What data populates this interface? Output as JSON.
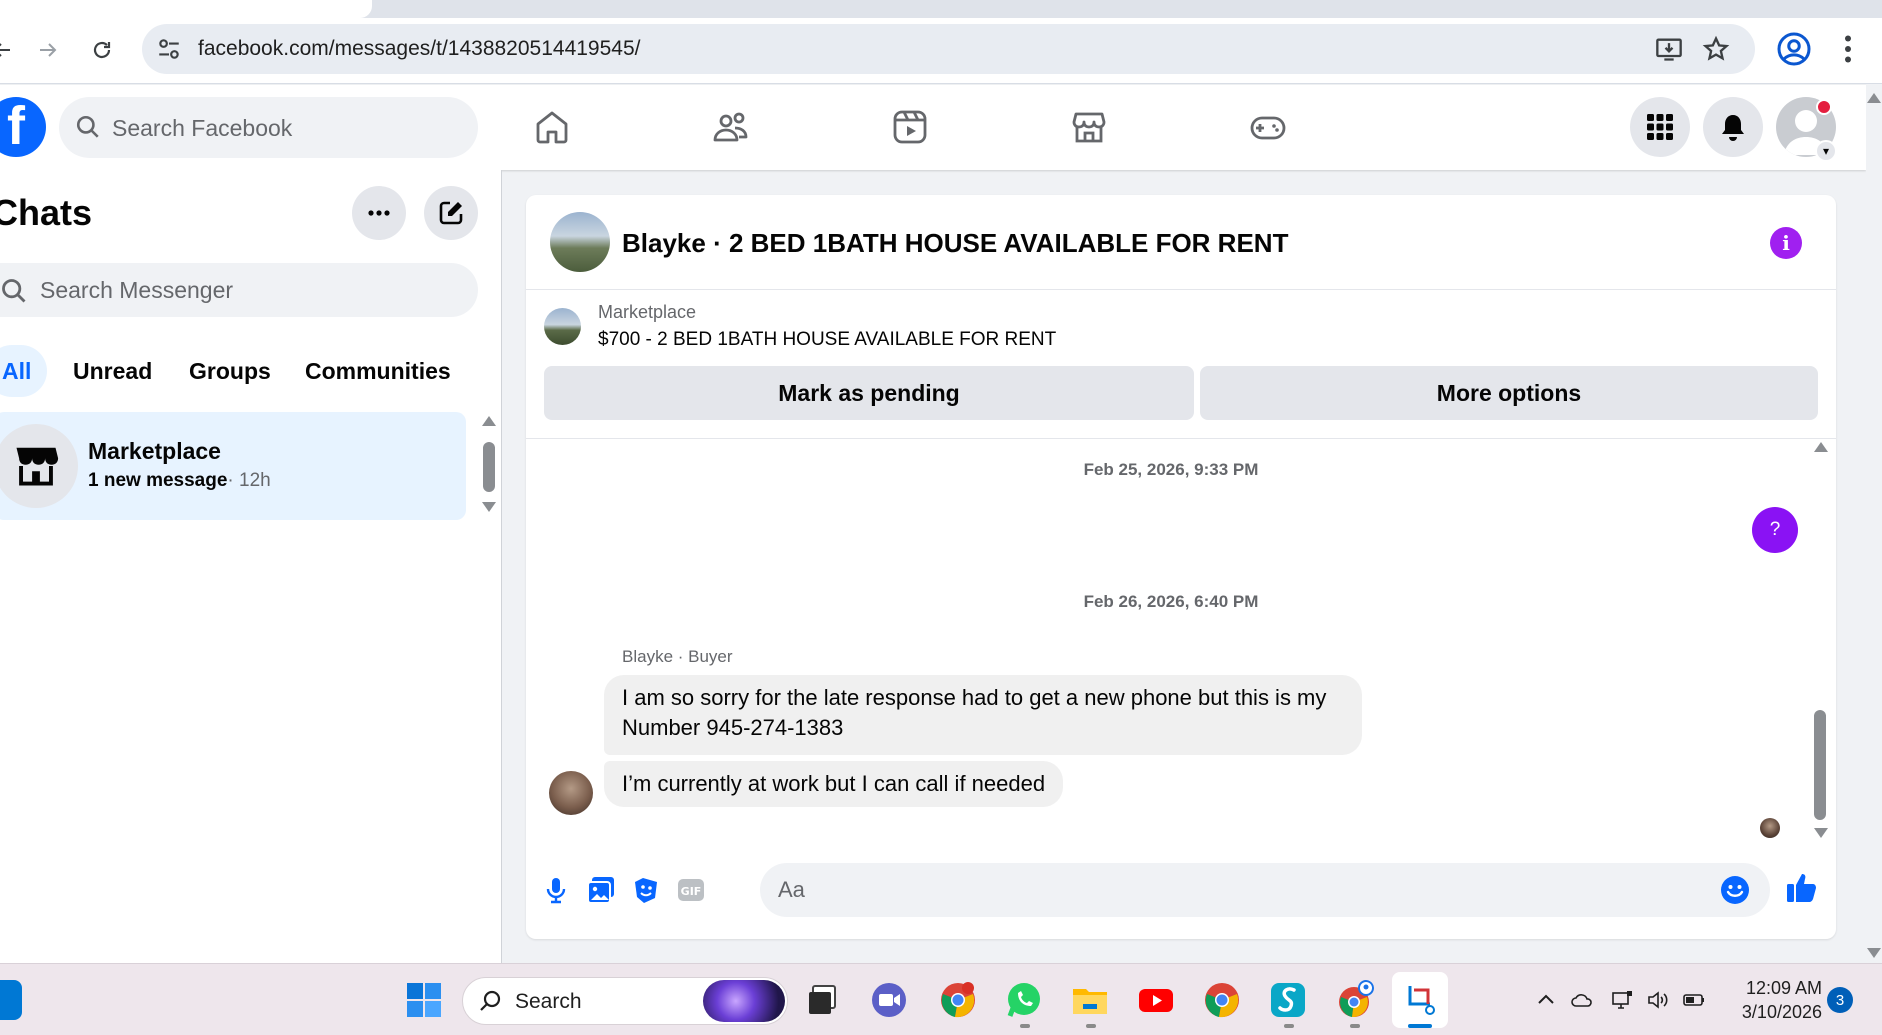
{
  "browser": {
    "url": "facebook.com/messages/t/1438820514419545/"
  },
  "fb": {
    "search_placeholder": "Search Facebook",
    "brand_color": "#0866ff"
  },
  "sidebar": {
    "title": "Chats",
    "search_placeholder": "Search Messenger",
    "filters": [
      "All",
      "Unread",
      "Groups",
      "Communities"
    ],
    "active_filter": "All",
    "chats": [
      {
        "name": "Marketplace",
        "preview": "1 new message",
        "time": "· 12h"
      }
    ]
  },
  "conversation": {
    "title": "Blayke · 2 BED 1BATH HOUSE AVAILABLE FOR RENT",
    "listing": {
      "kicker": "Marketplace",
      "title": "$700 - 2 BED 1BATH HOUSE AVAILABLE FOR RENT",
      "mark_pending": "Mark as pending",
      "more_options": "More options"
    },
    "timestamps": [
      "Feb 25, 2026, 9:33 PM",
      "Feb 26, 2026, 6:40 PM"
    ],
    "outgoing_bubble": "?",
    "sender_label": "Blayke · Buyer",
    "messages": [
      "I am so sorry for the late response had to get a new phone but this is my Number 945-274-1383",
      "I’m currently at work but I can call if needed"
    ],
    "composer_placeholder": "Aa",
    "accent_color": "#8a12f4"
  },
  "taskbar": {
    "search_placeholder": "Search",
    "time": "12:09 AM",
    "date": "3/10/2026",
    "notification_count": "3"
  }
}
